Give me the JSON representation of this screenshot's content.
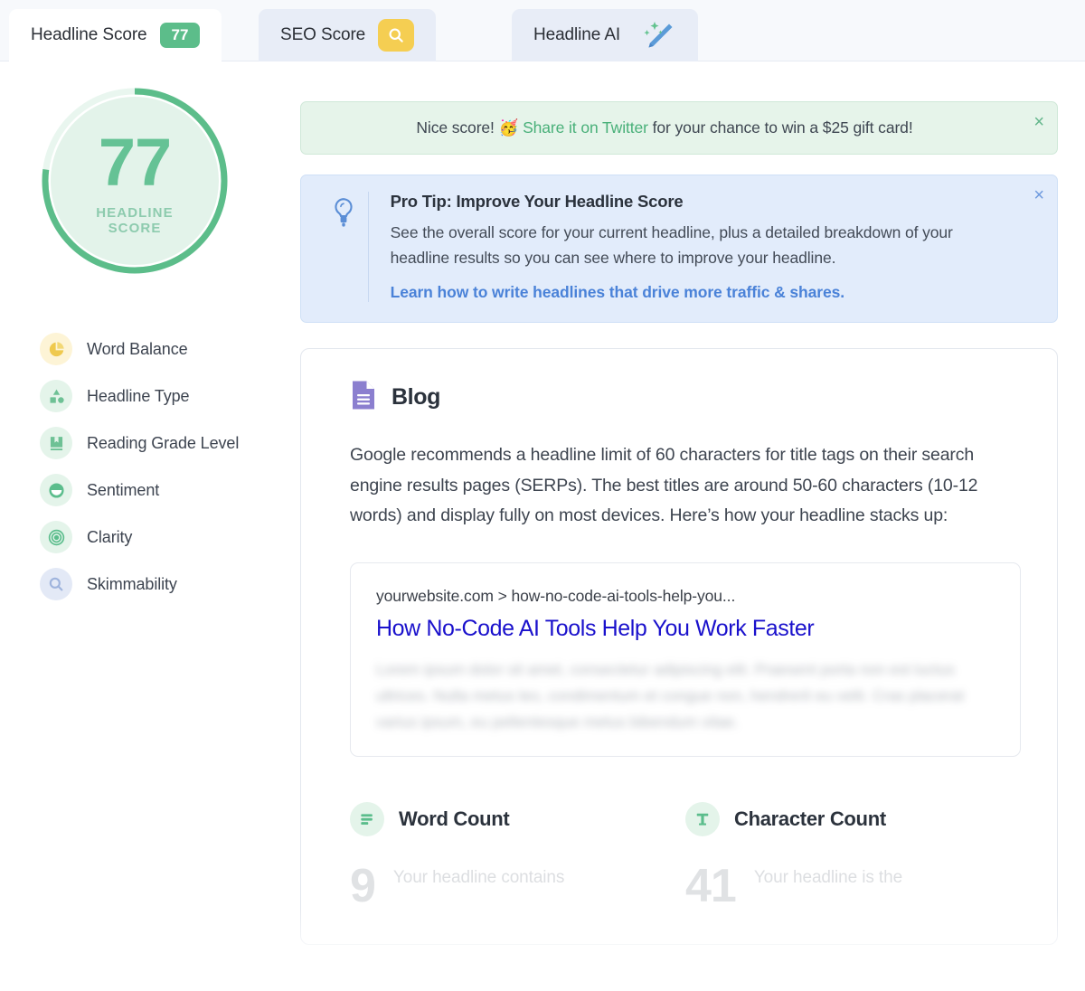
{
  "tabs": [
    {
      "label": "Headline Score",
      "badge": "77",
      "badge_icon": "score-badge",
      "active": true
    },
    {
      "label": "SEO Score",
      "badge": "",
      "badge_icon": "search-icon",
      "active": false
    },
    {
      "label": "Headline AI",
      "badge": "",
      "badge_icon": "sparkle-pencil-icon",
      "active": false
    }
  ],
  "score_ring": {
    "value": "77",
    "caption_line1": "HEADLINE",
    "caption_line2": "SCORE",
    "percent": 77,
    "track_color": "#e3f3ea",
    "arc_color": "#5cbd8a",
    "text_color": "#65c295"
  },
  "metrics": [
    {
      "label": "Word Balance",
      "icon": "pie-chart-icon",
      "icon_color": "#efc94e",
      "bg_color": "#fdf4d6"
    },
    {
      "label": "Headline Type",
      "icon": "shapes-icon",
      "icon_color": "#6ec195",
      "bg_color": "#e4f4ea"
    },
    {
      "label": "Reading Grade Level",
      "icon": "bookmark-icon",
      "icon_color": "#6ec195",
      "bg_color": "#e4f4ea"
    },
    {
      "label": "Sentiment",
      "icon": "neutral-face-icon",
      "icon_color": "#5bbd8c",
      "bg_color": "#e4f4ea"
    },
    {
      "label": "Clarity",
      "icon": "target-icon",
      "icon_color": "#5bbd8c",
      "bg_color": "#e4f4ea"
    },
    {
      "label": "Skimmability",
      "icon": "magnifier-icon",
      "icon_color": "#9fb4dd",
      "bg_color": "#e3e9f6"
    }
  ],
  "share_banner": {
    "prefix": "Nice score! ",
    "emoji": "🥳",
    "link": "Share it on Twitter",
    "suffix": " for your chance to win a $25 gift card!",
    "close": "×",
    "bg_color": "#e6f4ea",
    "link_color": "#49b079"
  },
  "pro_tip": {
    "icon": "lightbulb-icon",
    "title": "Pro Tip: Improve Your Headline Score",
    "body": "See the overall score for your current headline, plus a detailed breakdown of your headline results so you can see where to improve your headline.",
    "link": "Learn how to write headlines that drive more traffic & shares.",
    "close": "×",
    "bg_color": "#e2ecfb",
    "link_color": "#4a82d8"
  },
  "blog_card": {
    "icon": "document-icon",
    "title": "Blog",
    "paragraph": "Google recommends a headline limit of 60 characters for title tags on their search engine results pages (SERPs). The best titles are around 50-60 characters (10-12 words) and display fully on most devices. Here’s how your headline stacks up:",
    "serp_preview": {
      "url": "yourwebsite.com > how-no-code-ai-tools-help-you...",
      "title": "How No-Code AI Tools Help You Work Faster",
      "description": "Lorem ipsum dolor sit amet, consectetur adipiscing elit. Praesent porta non est luctus ultrices. Nulla metus leo, condimentum et congue non, hendrerit eu velit. Cras placerat varius ipsum, eu pellentesque metus bibendum vitae."
    },
    "word_count": {
      "icon": "lines-icon",
      "title": "Word Count",
      "value": "9",
      "description": "Your headline contains"
    },
    "character_count": {
      "icon": "text-t-icon",
      "title": "Character Count",
      "value": "41",
      "description": "Your headline is the"
    }
  }
}
